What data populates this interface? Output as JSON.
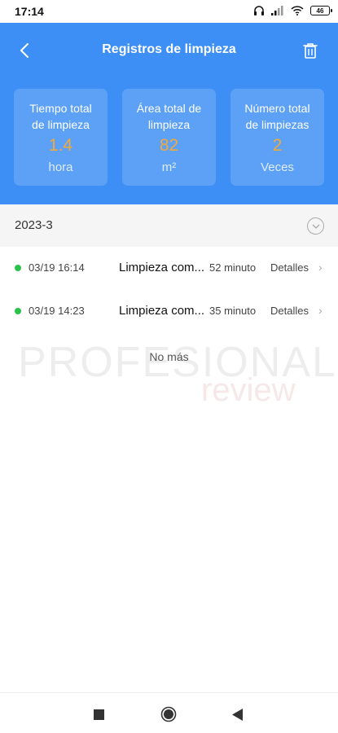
{
  "status_bar": {
    "time": "17:14",
    "battery": "46"
  },
  "header": {
    "title": "Registros de limpieza"
  },
  "stats": [
    {
      "label_line1": "Tiempo total",
      "label_line2": "de limpieza",
      "value": "1.4",
      "unit": "hora"
    },
    {
      "label_line1": "Área total de",
      "label_line2": "limpieza",
      "value": "82",
      "unit": "m²"
    },
    {
      "label_line1": "Número total",
      "label_line2": "de limpiezas",
      "value": "2",
      "unit": "Veces"
    }
  ],
  "month": {
    "label": "2023-3"
  },
  "records": [
    {
      "datetime": "03/19 16:14",
      "name": "Limpieza com...",
      "duration": "52 minuto",
      "details": "Detalles"
    },
    {
      "datetime": "03/19 14:23",
      "name": "Limpieza com...",
      "duration": "35 minuto",
      "details": "Detalles"
    }
  ],
  "no_more": "No más",
  "watermark": {
    "top": "PROFESIONAL",
    "bottom": "review"
  },
  "colors": {
    "header": "#3d8ff5",
    "value": "#f2a93b",
    "dot": "#2cc14b"
  }
}
